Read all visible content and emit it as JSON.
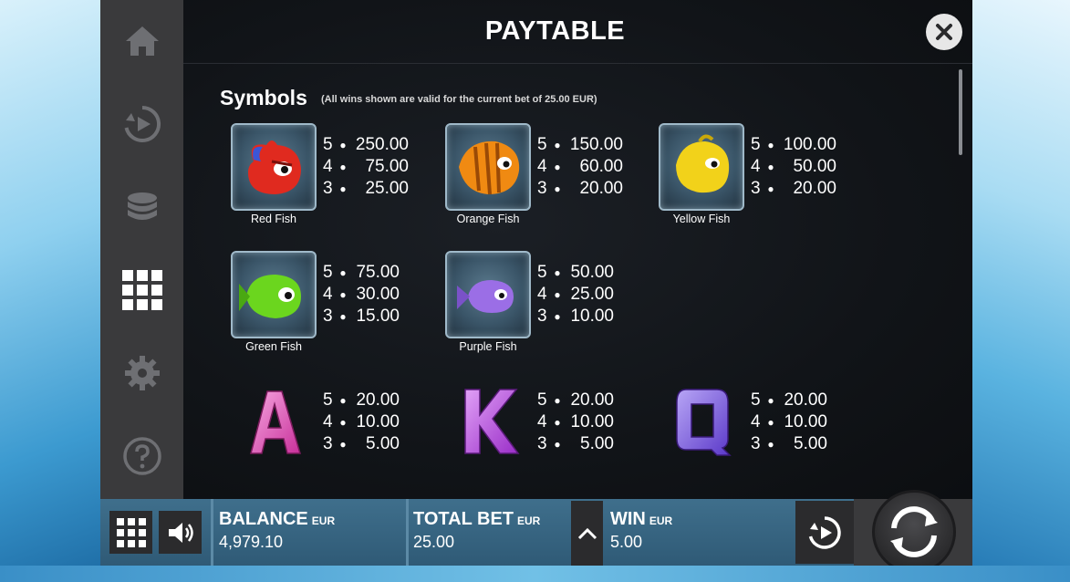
{
  "header": {
    "title": "PAYTABLE"
  },
  "section": {
    "title": "Symbols",
    "note": "(All wins shown are valid for the current bet of 25.00 EUR)"
  },
  "symbols": [
    {
      "name": "Red Fish",
      "color": "#e02a1f",
      "pays": [
        {
          "count": "5",
          "value": "250.00"
        },
        {
          "count": "4",
          "value": "75.00"
        },
        {
          "count": "3",
          "value": "25.00"
        }
      ]
    },
    {
      "name": "Orange Fish",
      "color": "#f08a12",
      "pays": [
        {
          "count": "5",
          "value": "150.00"
        },
        {
          "count": "4",
          "value": "60.00"
        },
        {
          "count": "3",
          "value": "20.00"
        }
      ]
    },
    {
      "name": "Yellow Fish",
      "color": "#f2d21a",
      "pays": [
        {
          "count": "5",
          "value": "100.00"
        },
        {
          "count": "4",
          "value": "50.00"
        },
        {
          "count": "3",
          "value": "20.00"
        }
      ]
    },
    {
      "name": "Green Fish",
      "color": "#6bd61e",
      "pays": [
        {
          "count": "5",
          "value": "75.00"
        },
        {
          "count": "4",
          "value": "30.00"
        },
        {
          "count": "3",
          "value": "15.00"
        }
      ]
    },
    {
      "name": "Purple Fish",
      "color": "#9b6ee6",
      "pays": [
        {
          "count": "5",
          "value": "50.00"
        },
        {
          "count": "4",
          "value": "25.00"
        },
        {
          "count": "3",
          "value": "10.00"
        }
      ]
    },
    {
      "name": "A",
      "color": "#e05ab8",
      "pays": [
        {
          "count": "5",
          "value": "20.00"
        },
        {
          "count": "4",
          "value": "10.00"
        },
        {
          "count": "3",
          "value": "5.00"
        }
      ]
    },
    {
      "name": "K",
      "color": "#b64ee0",
      "pays": [
        {
          "count": "5",
          "value": "20.00"
        },
        {
          "count": "4",
          "value": "10.00"
        },
        {
          "count": "3",
          "value": "5.00"
        }
      ]
    },
    {
      "name": "Q",
      "color": "#7a5ee6",
      "pays": [
        {
          "count": "5",
          "value": "20.00"
        },
        {
          "count": "4",
          "value": "10.00"
        },
        {
          "count": "3",
          "value": "5.00"
        }
      ]
    }
  ],
  "nav": {
    "items": [
      "home-icon",
      "replay-icon",
      "coins-icon",
      "grid-icon",
      "gear-icon",
      "help-icon"
    ],
    "active": "grid-icon"
  },
  "bottombar": {
    "balance_label": "BALANCE",
    "balance_currency": "EUR",
    "balance_value": "4,979.10",
    "bet_label": "TOTAL BET",
    "bet_currency": "EUR",
    "bet_value": "25.00",
    "win_label": "WIN",
    "win_currency": "EUR",
    "win_value": "5.00"
  },
  "colors": {
    "accent": "#3f6f8c",
    "panel": "#111418",
    "nav": "#3a3a3c"
  }
}
